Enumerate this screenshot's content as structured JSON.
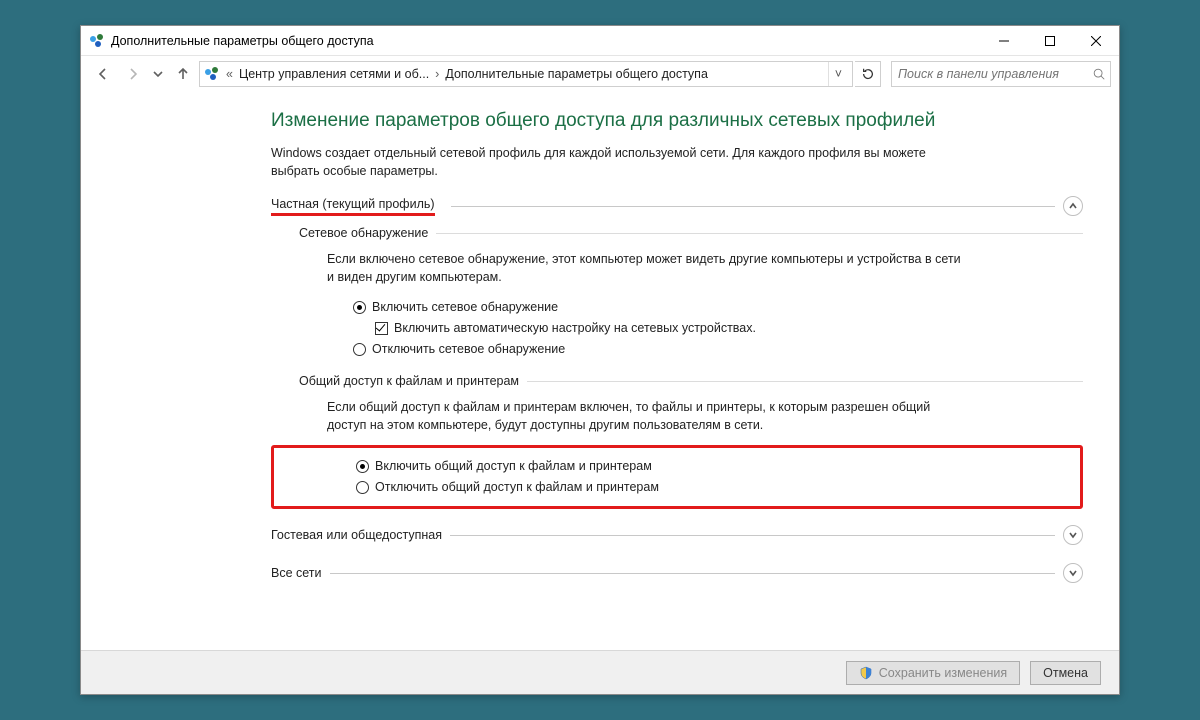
{
  "window": {
    "title": "Дополнительные параметры общего доступа"
  },
  "nav": {
    "crumb1": "Центр управления сетями и об...",
    "crumb2": "Дополнительные параметры общего доступа",
    "search_placeholder": "Поиск в панели управления"
  },
  "page": {
    "heading": "Изменение параметров общего доступа для различных сетевых профилей",
    "intro": "Windows создает отдельный сетевой профиль для каждой используемой сети. Для каждого профиля вы можете выбрать особые параметры."
  },
  "profiles": {
    "private": {
      "label": "Частная (текущий профиль)",
      "discovery": {
        "title": "Сетевое обнаружение",
        "desc": "Если включено сетевое обнаружение, этот компьютер может видеть другие компьютеры и устройства в сети и виден другим компьютерам.",
        "opt_on": "Включить сетевое обнаружение",
        "opt_auto": "Включить автоматическую настройку на сетевых устройствах.",
        "opt_off": "Отключить сетевое обнаружение"
      },
      "fileshare": {
        "title": "Общий доступ к файлам и принтерам",
        "desc": "Если общий доступ к файлам и принтерам включен, то файлы и принтеры, к которым разрешен общий доступ на этом компьютере, будут доступны другим пользователям в сети.",
        "opt_on": "Включить общий доступ к файлам и принтерам",
        "opt_off": "Отключить общий доступ к файлам и принтерам"
      }
    },
    "guest": {
      "label": "Гостевая или общедоступная"
    },
    "all": {
      "label": "Все сети"
    }
  },
  "footer": {
    "save": "Сохранить изменения",
    "cancel": "Отмена"
  }
}
